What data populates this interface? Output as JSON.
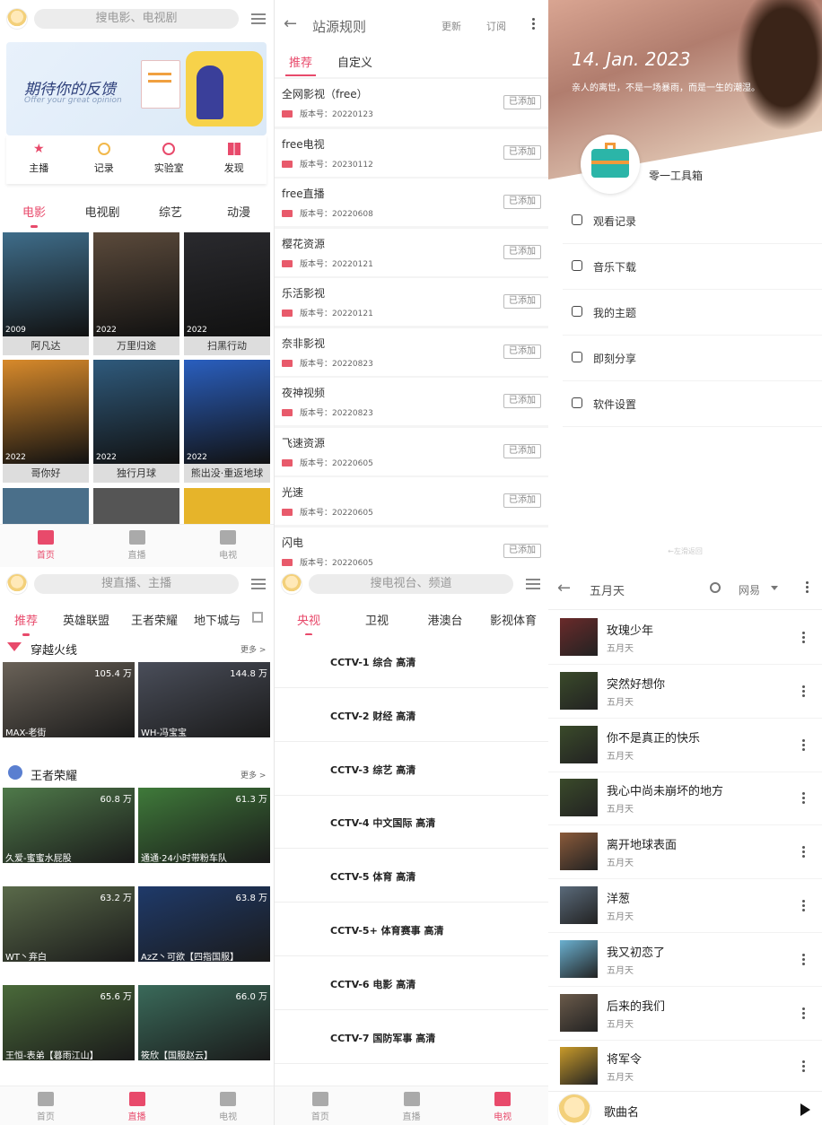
{
  "home": {
    "search_placeholder": "搜电影、电视剧",
    "banner_title": "期待你的反馈",
    "banner_subtitle": "Offer your great opinion",
    "quick": [
      {
        "label": "主播",
        "icon": "star-icon"
      },
      {
        "label": "记录",
        "icon": "clock-icon"
      },
      {
        "label": "实验室",
        "icon": "smile-icon"
      },
      {
        "label": "发现",
        "icon": "grid-icon"
      }
    ],
    "tabs": [
      "电影",
      "电视剧",
      "综艺",
      "动漫"
    ],
    "movies": [
      {
        "title": "阿凡达",
        "year": "2009",
        "color": "#3f6d8a"
      },
      {
        "title": "万里归途",
        "year": "2022",
        "color": "#5b4a3b"
      },
      {
        "title": "扫黑行动",
        "year": "2022",
        "color": "#2a2a2e"
      },
      {
        "title": "哥你好",
        "year": "2022",
        "color": "#d88a2b"
      },
      {
        "title": "独行月球",
        "year": "2022",
        "color": "#2f5a7c"
      },
      {
        "title": "熊出没·重返地球",
        "year": "2022",
        "color": "#2a5fbf"
      }
    ],
    "nav": [
      "首页",
      "直播",
      "电视"
    ]
  },
  "sources": {
    "title": "站源规则",
    "update": "更新",
    "subscribe": "订阅",
    "tabs": [
      "推荐",
      "自定义"
    ],
    "items": [
      {
        "name": "全网影视（free）",
        "version": "版本号：20220123"
      },
      {
        "name": "free电视",
        "version": "版本号：20230112"
      },
      {
        "name": "free直播",
        "version": "版本号：20220608"
      },
      {
        "name": "樱花资源",
        "version": "版本号：20220121"
      },
      {
        "name": "乐活影视",
        "version": "版本号：20220121"
      },
      {
        "name": "奈非影视",
        "version": "版本号：20220823"
      },
      {
        "name": "夜神视频",
        "version": "版本号：20220823"
      },
      {
        "name": "飞速资源",
        "version": "版本号：20220605"
      },
      {
        "name": "光速",
        "version": "版本号：20220605"
      },
      {
        "name": "闪电",
        "version": "版本号：20220605"
      }
    ],
    "added_label": "已添加"
  },
  "drawer": {
    "date": "14. Jan. 2023",
    "quote": "亲人的离世，不是一场暴雨，而是一生的潮湿。",
    "app_name": "零一工具箱",
    "menu": [
      {
        "label": "观看记录",
        "icon": "history-icon"
      },
      {
        "label": "音乐下载",
        "icon": "music-icon"
      },
      {
        "label": "我的主题",
        "icon": "palette-icon"
      },
      {
        "label": "即刻分享",
        "icon": "send-icon"
      },
      {
        "label": "软件设置",
        "icon": "settings-icon"
      }
    ],
    "hint": "←左滑返回"
  },
  "live": {
    "search_placeholder": "搜直播、主播",
    "tabs": [
      "推荐",
      "英雄联盟",
      "王者荣耀",
      "地下城与"
    ],
    "more": "更多 >",
    "sections": [
      {
        "title": "穿越火线",
        "cards": [
          {
            "name": "MAX-老街",
            "count": "105.4 万",
            "color": "#6a6258"
          },
          {
            "name": "WH-冯宝宝",
            "count": "144.8 万",
            "color": "#4a4e5a"
          }
        ]
      },
      {
        "title": "王者荣耀",
        "cards": [
          {
            "name": "久爱-蜜蜜水屁股",
            "count": "60.8 万",
            "color": "#4f7a4a"
          },
          {
            "name": "通通·24小时带粉车队",
            "count": "61.3 万",
            "color": "#3f7a3a"
          },
          {
            "name": "WT丶弃白",
            "count": "63.2 万",
            "color": "#5a6a4a"
          },
          {
            "name": "AzZ丶可欲【四指国服】",
            "count": "63.8 万",
            "color": "#1f3a6a"
          },
          {
            "name": "王恒-表弟【暮雨江山】",
            "count": "65.6 万",
            "color": "#4a6a3a"
          },
          {
            "name": "筱欣【国服赵云】",
            "count": "66.0 万",
            "color": "#3a6a5a"
          }
        ]
      }
    ],
    "nav": [
      "首页",
      "直播",
      "电视"
    ]
  },
  "tv": {
    "search_placeholder": "搜电视台、频道",
    "tabs": [
      "央视",
      "卫视",
      "港澳台",
      "影视体育"
    ],
    "channels": [
      "CCTV-1 综合 高清",
      "CCTV-2 财经 高清",
      "CCTV-3 综艺 高清",
      "CCTV-4 中文国际 高清",
      "CCTV-5 体育 高清",
      "CCTV-5+ 体育赛事 高清",
      "CCTV-6 电影 高清",
      "CCTV-7 国防军事 高清"
    ],
    "nav": [
      "首页",
      "直播",
      "电视"
    ]
  },
  "music": {
    "query": "五月天",
    "provider": "网易",
    "songs": [
      {
        "title": "玫瑰少年",
        "artist": "五月天",
        "color": "#6a2a2a"
      },
      {
        "title": "突然好想你",
        "artist": "五月天",
        "color": "#3a4a2a"
      },
      {
        "title": "你不是真正的快乐",
        "artist": "五月天",
        "color": "#3a4a2a"
      },
      {
        "title": "我心中尚未崩坏的地方",
        "artist": "五月天",
        "color": "#3a4a2a"
      },
      {
        "title": "离开地球表面",
        "artist": "五月天",
        "color": "#8a5a3a"
      },
      {
        "title": "洋葱",
        "artist": "五月天",
        "color": "#5a6a7a"
      },
      {
        "title": "我又初恋了",
        "artist": "五月天",
        "color": "#6ab0d0"
      },
      {
        "title": "后来的我们",
        "artist": "五月天",
        "color": "#6a5a4a"
      },
      {
        "title": "将军令",
        "artist": "五月天",
        "color": "#c89a2a"
      }
    ],
    "player_title": "歌曲名"
  }
}
